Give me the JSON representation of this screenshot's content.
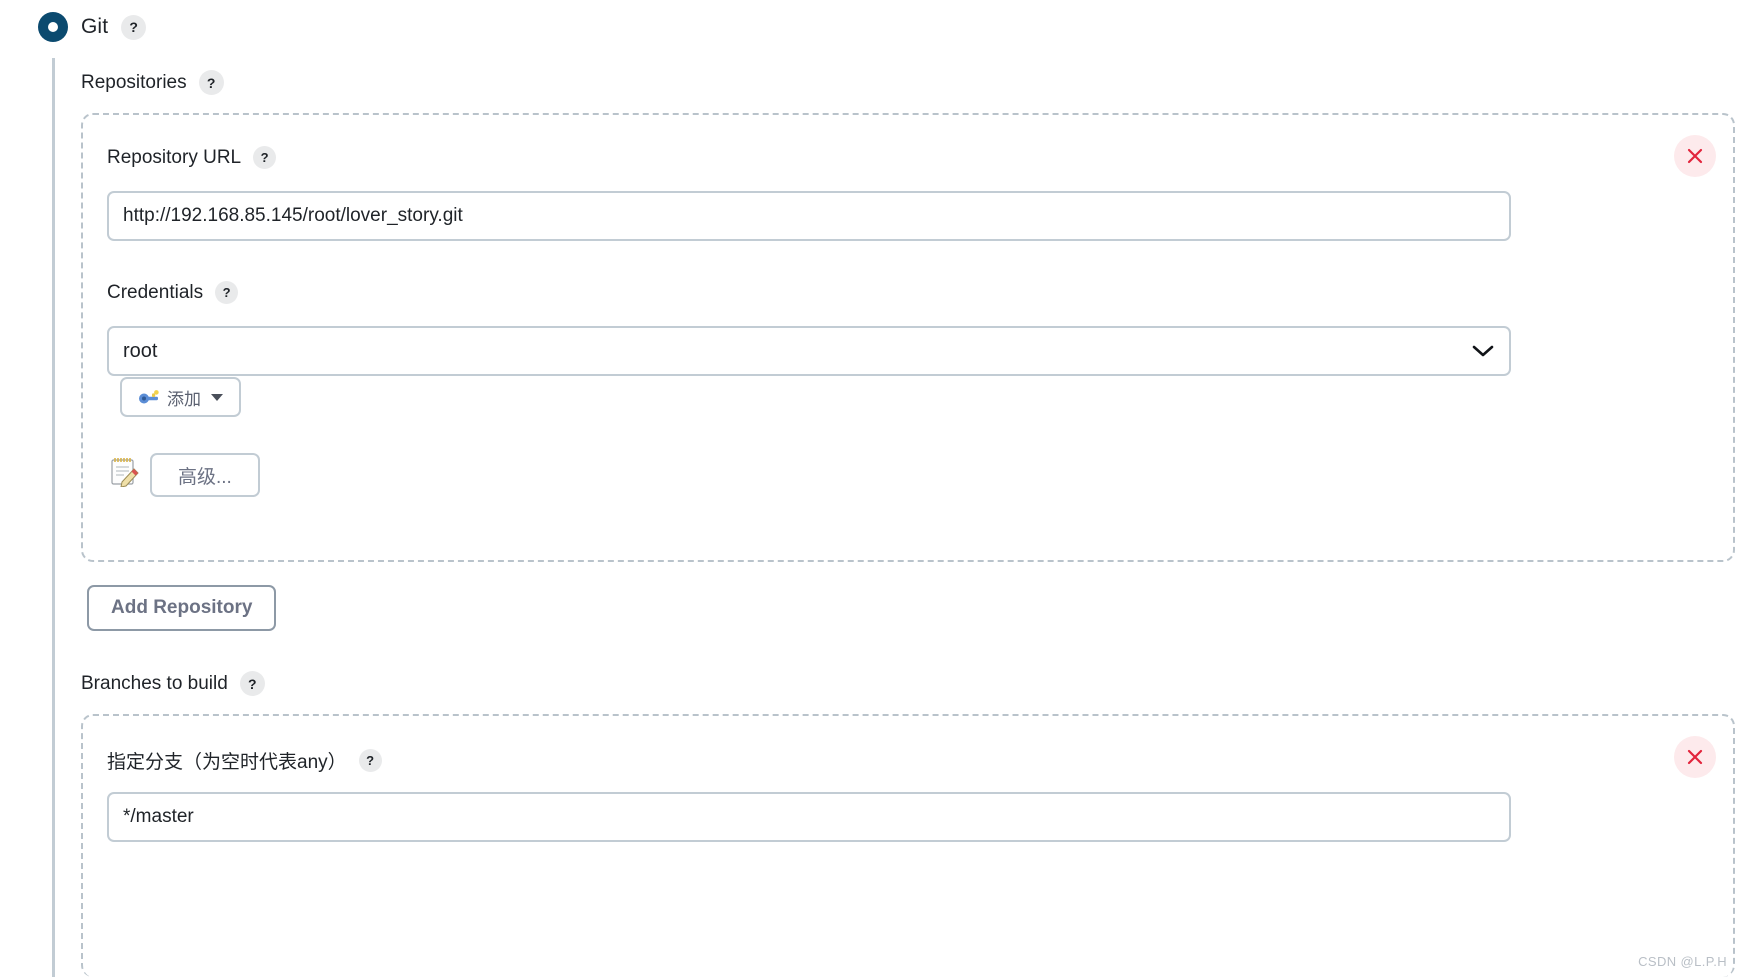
{
  "scm": {
    "selected_label": "Git",
    "help_label": "?",
    "radio_color": "#0b4a6f"
  },
  "repositories": {
    "heading": "Repositories",
    "help_label": "?",
    "repo": {
      "url_label": "Repository URL",
      "url_help": "?",
      "url_value": "http://192.168.85.145/root/lover_story.git",
      "url_placeholder": "",
      "credentials_label": "Credentials",
      "credentials_help": "?",
      "credentials_value": "root",
      "credentials_options": [
        "root"
      ],
      "add_credentials_label": "添加",
      "advanced_label": "高级...",
      "remove_label": "✕"
    },
    "add_repository_label": "Add Repository"
  },
  "branches": {
    "heading": "Branches to build",
    "help_label": "?",
    "branch": {
      "name_label": "指定分支（为空时代表any）",
      "name_help": "?",
      "name_value": "*/master",
      "name_placeholder": "",
      "remove_label": "✕"
    }
  },
  "watermark": {
    "text": "CSDN @L.P.H"
  },
  "colors": {
    "accent": "#0b4a6f",
    "danger": "#e2243c",
    "danger_bg": "#fdeaec",
    "border": "#c2ccd4",
    "dashed_border": "#b9c3cb",
    "button_text": "#6c7284"
  }
}
